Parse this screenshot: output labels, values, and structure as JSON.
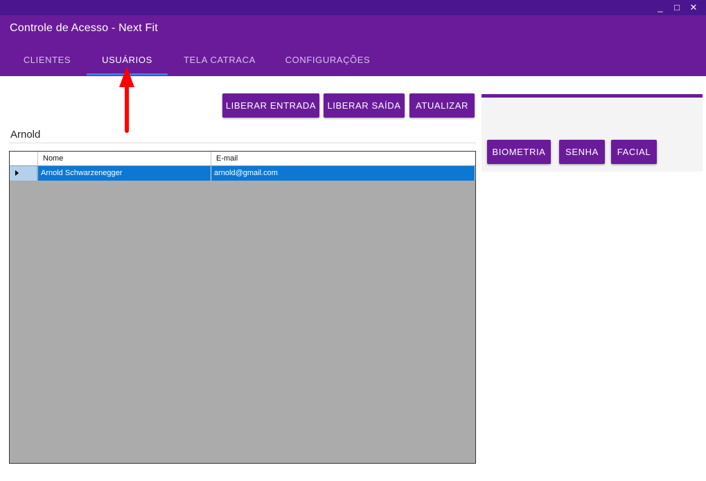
{
  "window": {
    "minimize": "_",
    "maximize": "□",
    "close": "✕"
  },
  "app": {
    "title": "Controle de Acesso - Next Fit"
  },
  "tabs": [
    {
      "label": "CLIENTES"
    },
    {
      "label": "USUÁRIOS",
      "active": true
    },
    {
      "label": "TELA CATRACA"
    },
    {
      "label": "CONFIGURAÇÕES"
    }
  ],
  "actions": {
    "liberar_entrada": "LIBERAR ENTRADA",
    "liberar_saida": "LIBERAR SAÍDA",
    "atualizar": "ATUALIZAR"
  },
  "selected_user": {
    "name": "Arnold"
  },
  "table": {
    "columns": [
      "Nome",
      "E-mail"
    ],
    "rows": [
      {
        "nome": "Arnold Schwarzenegger",
        "email": "arnold@gmail.com",
        "selected": true
      }
    ]
  },
  "panel": {
    "biometria": "BIOMETRIA",
    "senha": "SENHA",
    "facial": "FACIAL"
  },
  "colors": {
    "header": "#6a1b9a",
    "titlebar": "#4a168f",
    "selection": "#0d78d4",
    "tab_indicator": "#3f7ee8",
    "annotation_arrow": "#ff0000"
  }
}
